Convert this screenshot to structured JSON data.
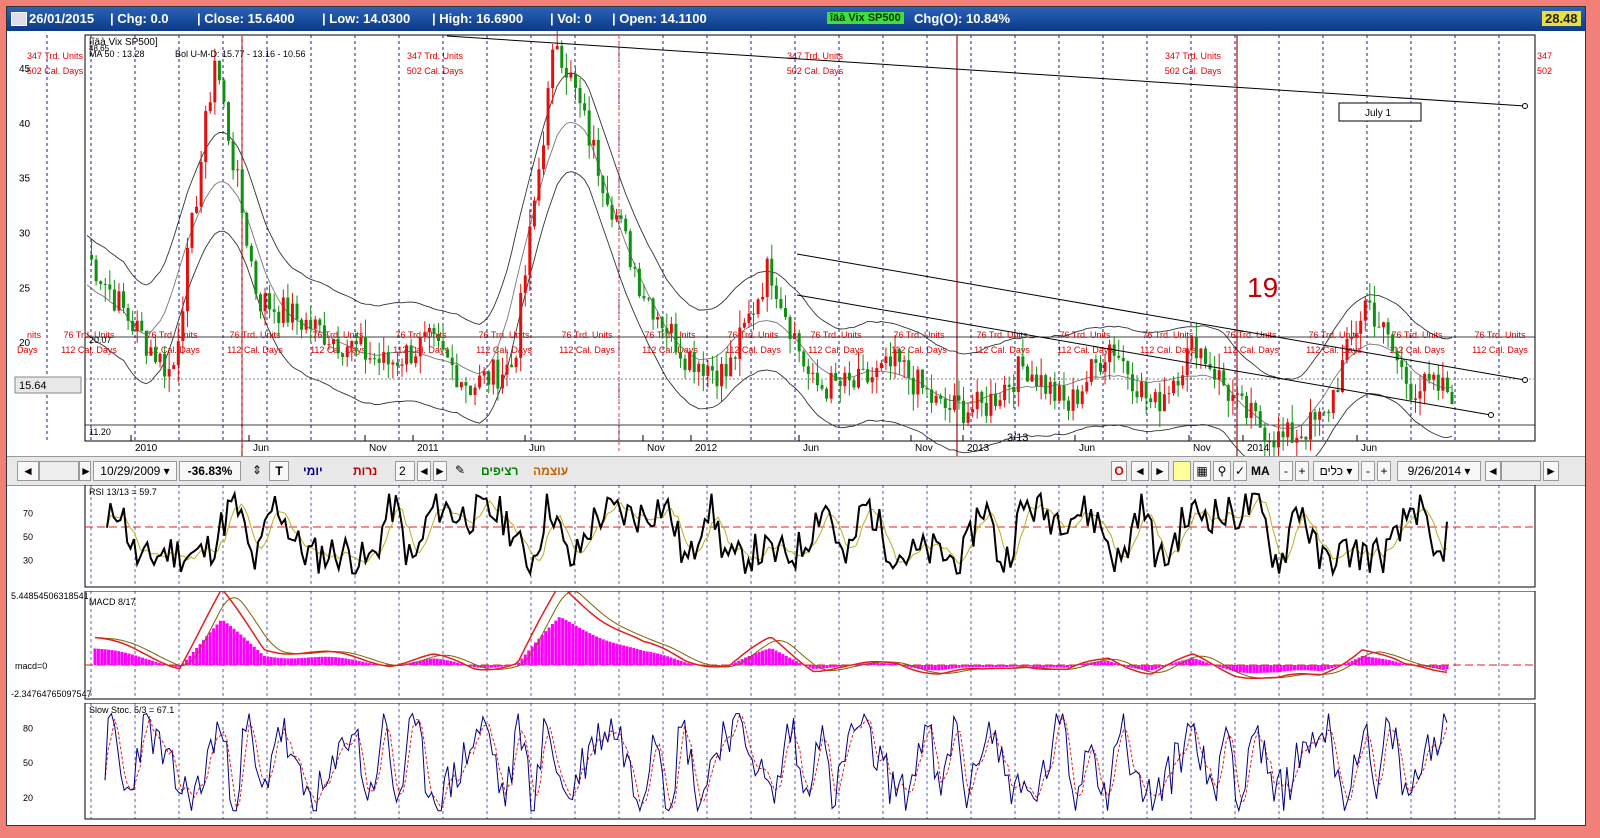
{
  "infobar": {
    "date": "26/01/2015",
    "chg": "| Chg: 0.0",
    "close": "| Close: 15.6400",
    "low": "| Low: 14.0300",
    "high": "| High: 16.6900",
    "vol": "| Vol: 0",
    "open": "| Open: 14.1100",
    "symbol": "îäà Vix SP500",
    "chgo": "Chg(O): 10.84%",
    "corner_value": "28.48"
  },
  "main_chart": {
    "symbol_label": "[îäà Vix SP500]",
    "top_label": "48.65",
    "ma_label": "MA 50 : 13.28",
    "bol_label": "Bol U-M-D: 15.77 - 13.16 - 10.56",
    "mid_label": "20.07",
    "last_label": "15.64",
    "low_label": "11.20",
    "big_label": "19",
    "box_label": "July 1",
    "annot_313": "3/13",
    "y_ticks": [
      "45",
      "40",
      "35",
      "30",
      "25",
      "20"
    ],
    "x_labels": [
      "2010",
      "Jun",
      "Nov",
      "2011",
      "Jun",
      "Nov",
      "2012",
      "Jun",
      "Nov",
      "2013",
      "Jun",
      "Nov",
      "2014",
      "Jun"
    ],
    "cycle_top_a": "347 Trd. Units",
    "cycle_top_b": "502 Cal. Days",
    "cycle_mid_a": "76 Trd. Units",
    "cycle_mid_b": "112 Cal. Days",
    "edge_label_a": "347",
    "edge_label_b": "502",
    "left_edge_a": "nits",
    "left_edge_b": "Days"
  },
  "toolbar": {
    "start_date": "10/29/2009",
    "pct": "-36.83%",
    "t_label": "T",
    "daily": "יומי",
    "candles": "נרות",
    "num": "2",
    "continuous": "רציפים",
    "strength": "עוצמה",
    "o_label": "O",
    "ma_label": "MA",
    "tools": "כלים",
    "end_date": "9/26/2014"
  },
  "rsi": {
    "title": "RSI 13/13 = 59.7",
    "ticks": [
      "70",
      "50",
      "30"
    ],
    "color_line": "#000000",
    "color_signal": "#b8b020"
  },
  "macd": {
    "title": "MACD 8/17",
    "top_value": "5.44854506318541",
    "bottom_value": "-2.34764765097547",
    "zero_label": "macd=0",
    "color_hist": "#ff00ff",
    "color_line": "#e02020"
  },
  "stoch": {
    "title": "Slow Stoc. 5/3 = 67.1",
    "ticks": [
      "80",
      "50",
      "20"
    ],
    "color_k": "#000080",
    "color_d": "#e02020"
  },
  "chart_data": {
    "type": "line",
    "title": "îäà Vix SP500",
    "x_range": [
      "2009-10-29",
      "2015-01-26"
    ],
    "ylim": [
      11,
      48
    ],
    "x": [
      "2009-11",
      "2010-01",
      "2010-03",
      "2010-05",
      "2010-07",
      "2010-09",
      "2010-11",
      "2011-01",
      "2011-03",
      "2011-05",
      "2011-07",
      "2011-08",
      "2011-10",
      "2011-12",
      "2012-02",
      "2012-04",
      "2012-06",
      "2012-08",
      "2012-10",
      "2012-12",
      "2013-02",
      "2013-04",
      "2013-06",
      "2013-08",
      "2013-10",
      "2013-12",
      "2014-02",
      "2014-04",
      "2014-06",
      "2014-08",
      "2014-10",
      "2014-12",
      "2015-01"
    ],
    "series": [
      {
        "values": [
          28,
          22,
          17,
          46,
          24,
          22,
          20,
          18,
          20,
          16,
          18,
          48,
          36,
          25,
          19,
          17,
          27,
          16,
          16,
          18,
          14,
          14,
          18,
          14,
          20,
          14,
          20,
          14,
          11,
          13,
          24,
          16,
          15.6
        ]
      }
    ]
  }
}
